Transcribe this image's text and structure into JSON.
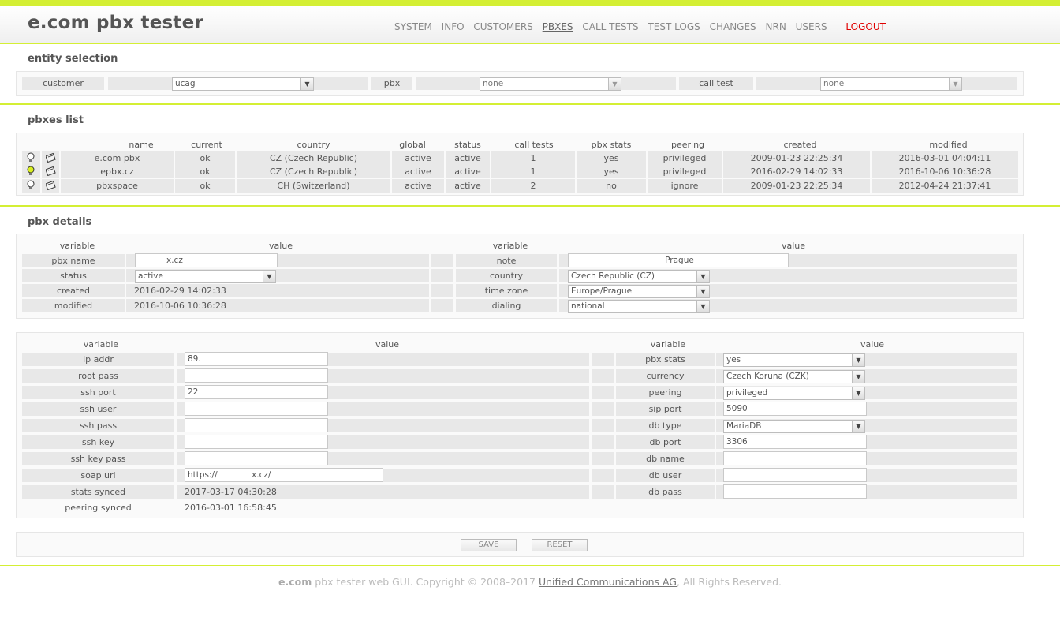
{
  "app": {
    "title": "e.com pbx tester"
  },
  "nav": {
    "items": [
      "SYSTEM",
      "INFO",
      "CUSTOMERS",
      "PBXES",
      "CALL TESTS",
      "TEST LOGS",
      "CHANGES",
      "NRN",
      "USERS"
    ],
    "logout": "LOGOUT",
    "active": "PBXES"
  },
  "entity_selection": {
    "title": "entity selection",
    "customer_label": "customer",
    "customer_value": "ucag",
    "pbx_label": "pbx",
    "pbx_value": "none",
    "call_test_label": "call test",
    "call_test_value": "none"
  },
  "pbxes_list": {
    "title": "pbxes list",
    "columns": [
      "name",
      "current",
      "country",
      "global",
      "status",
      "call tests",
      "pbx stats",
      "peering",
      "created",
      "modified"
    ],
    "rows": [
      {
        "name": "e.com pbx",
        "current": "ok",
        "country": "CZ (Czech Republic)",
        "global": "active",
        "status": "active",
        "call_tests": "1",
        "pbx_stats": "yes",
        "peering": "privileged",
        "created": "2009-01-23 22:25:34",
        "modified": "2016-03-01 04:04:11",
        "bulb": "off"
      },
      {
        "name": "epbx.cz",
        "current": "ok",
        "country": "CZ (Czech Republic)",
        "global": "active",
        "status": "active",
        "call_tests": "1",
        "pbx_stats": "yes",
        "peering": "privileged",
        "created": "2016-02-29 14:02:33",
        "modified": "2016-10-06 10:36:28",
        "bulb": "on"
      },
      {
        "name": "pbxspace",
        "current": "ok",
        "country": "CH (Switzerland)",
        "global": "active",
        "status": "active",
        "call_tests": "2",
        "pbx_stats": "no",
        "peering": "ignore",
        "created": "2009-01-23 22:25:34",
        "modified": "2012-04-24 21:37:41",
        "bulb": "off"
      }
    ]
  },
  "pbx_details": {
    "title": "pbx details",
    "h_variable": "variable",
    "h_value": "value",
    "pbx_name_label": "pbx name",
    "pbx_name_value": "x.cz",
    "status_label": "status",
    "status_value": "active",
    "created_label": "created",
    "created_value": "2016-02-29 14:02:33",
    "modified_label": "modified",
    "modified_value": "2016-10-06 10:36:28",
    "note_label": "note",
    "note_value": "Prague",
    "country_label": "country",
    "country_value": "Czech Republic (CZ)",
    "timezone_label": "time zone",
    "timezone_value": "Europe/Prague",
    "dialing_label": "dialing",
    "dialing_value": "national"
  },
  "connection": {
    "ip_addr_label": "ip addr",
    "ip_addr_value": "89.",
    "root_pass_label": "root pass",
    "root_pass_value": "",
    "ssh_port_label": "ssh port",
    "ssh_port_value": "22",
    "ssh_user_label": "ssh user",
    "ssh_user_value": "",
    "ssh_pass_label": "ssh pass",
    "ssh_pass_value": "",
    "ssh_key_label": "ssh key",
    "ssh_key_value": "",
    "ssh_key_pass_label": "ssh key pass",
    "ssh_key_pass_value": "",
    "soap_url_label": "soap url",
    "soap_url_value": "https://             x.cz/",
    "stats_synced_label": "stats synced",
    "stats_synced_value": "2017-03-17 04:30:28",
    "peering_synced_label": "peering synced",
    "peering_synced_value": "2016-03-01 16:58:45",
    "pbx_stats_label": "pbx stats",
    "pbx_stats_value": "yes",
    "currency_label": "currency",
    "currency_value": "Czech Koruna (CZK)",
    "peering_label": "peering",
    "peering_value": "privileged",
    "sip_port_label": "sip port",
    "sip_port_value": "5090",
    "db_type_label": "db type",
    "db_type_value": "MariaDB",
    "db_port_label": "db port",
    "db_port_value": "3306",
    "db_name_label": "db name",
    "db_name_value": "",
    "db_user_label": "db user",
    "db_user_value": "",
    "db_pass_label": "db pass",
    "db_pass_value": ""
  },
  "buttons": {
    "save": "SAVE",
    "reset": "RESET"
  },
  "footer": {
    "brand": "e.com",
    "text": " pbx tester web GUI. Copyright © 2008–2017 ",
    "link": "Unified Communications AG",
    "suffix": ", All Rights Reserved."
  },
  "colors": {
    "accent": "#d4ef34",
    "logout": "#e00000",
    "row_bg": "#e8e8e8"
  },
  "icons": {
    "bulb": "lightbulb-icon",
    "edit": "edit-icon",
    "dropdown": "chevron-down-icon"
  }
}
